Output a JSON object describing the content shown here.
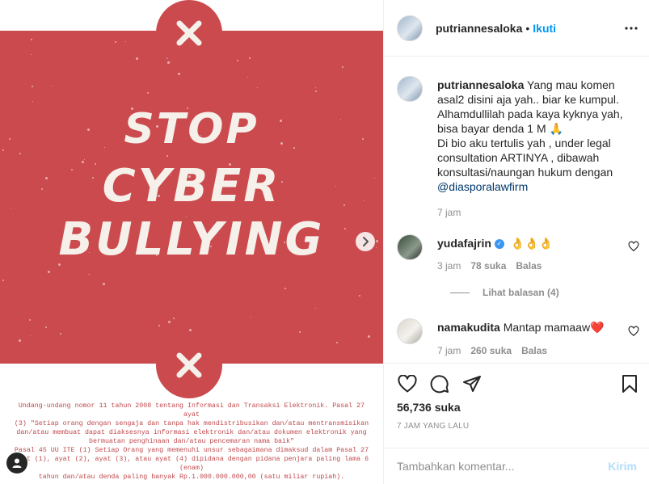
{
  "post_image": {
    "headline": [
      "STOP",
      "CYBER",
      "BULLYING"
    ],
    "law_text": [
      "Undang-undang nomor 11 tahun 2008 tentang Informasi dan Transaksi Elektronik. Pasal 27 ayat",
      "(3) \"Setiap orang dengan sengaja dan tanpa hak mendistribusikan dan/atau mentransmisikan",
      "dan/atau membuat dapat diaksesnya informasi elektronik dan/atau dokumen elektronik yang",
      "bermuatan penghinaan dan/atau pencemaran nama baik\"",
      "Pasal 45 UU ITE (1) Setiap Orang yang memenuhi unsur sebagaimana dimaksud dalam Pasal 27",
      "ayat (1), ayat (2), ayat (3), atau ayat (4) dipidana dengan pidana penjara paling lama 6 (enam)",
      "tahun dan/atau denda paling banyak Rp.1.000.000.000,00 (satu miliar rupiah)."
    ],
    "colors": {
      "panel": "#cb4a4e",
      "headline": "#f6f0ea"
    }
  },
  "header": {
    "username": "putriannesaloka",
    "separator": "•",
    "follow_label": "Ikuti",
    "more_icon": "more-horizontal-icon"
  },
  "caption": {
    "username": "putriannesaloka",
    "text": "Yang mau komen asal2 disini aja yah.. biar ke kumpul. Alhamdullilah pada kaya kyknya yah, bisa bayar denda 1 M 🙏",
    "text2": "Di bio aku tertulis yah , under legal consultation ARTINYA , dibawah konsultasi/naungan hukum dengan",
    "mention": "@diasporalawfirm",
    "time": "7 jam"
  },
  "comments": [
    {
      "username": "yudafajrin",
      "verified": true,
      "text": "👌👌👌",
      "time": "3 jam",
      "likes": "78 suka",
      "reply_label": "Balas",
      "view_replies": "Lihat balasan (4)"
    },
    {
      "username": "namakudita",
      "verified": false,
      "text": "Mantap mamaaw❤️",
      "time": "7 jam",
      "likes": "260 suka",
      "reply_label": "Balas"
    }
  ],
  "actions": {
    "like_icon": "heart-icon",
    "comment_icon": "comment-icon",
    "share_icon": "share-icon",
    "save_icon": "bookmark-icon",
    "likes_count": "56,736 suka",
    "posted_time": "7 JAM YANG LALU"
  },
  "add_comment": {
    "placeholder": "Tambahkan komentar...",
    "post_label": "Kirim"
  },
  "accent": "#0095f6"
}
